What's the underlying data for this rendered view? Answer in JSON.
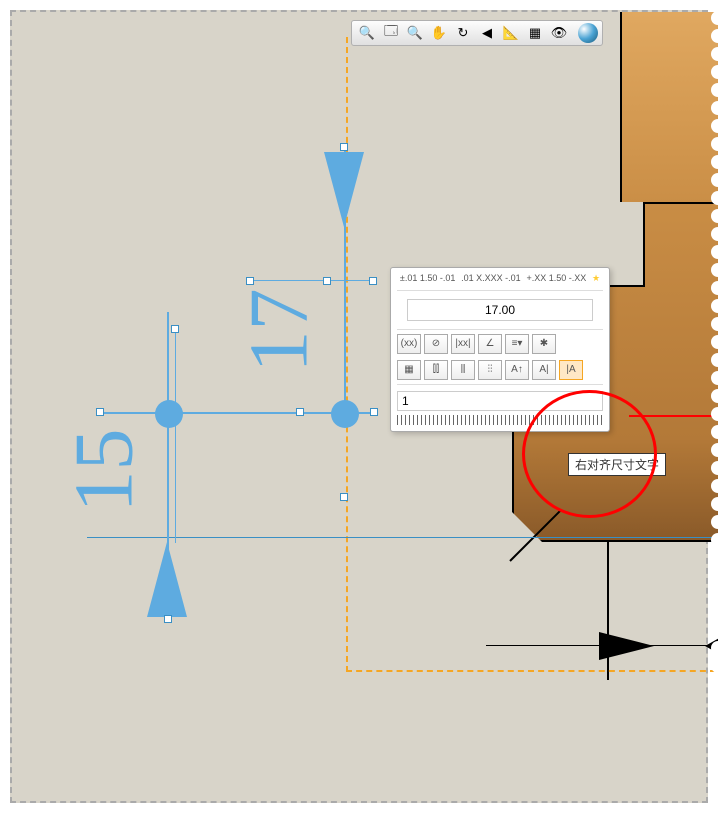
{
  "toolbar": {
    "zoom_area": "🔍",
    "zoom_fit": "🗔",
    "zoom": "🔍",
    "pan": "✋",
    "rotate": "↻",
    "prev_view": "◀",
    "section": "📐",
    "display": "▦",
    "vis": "👁"
  },
  "dimensions": {
    "d15": "15",
    "d17": "17"
  },
  "tolerance_panel": {
    "tol1": "±.01\n1.50\n-.01",
    "tol2": ".01\nX.XXX\n-.01",
    "tol3": "+.XX\n1.50\n-.XX",
    "value": "17.00",
    "count": "1"
  },
  "buttons": {
    "br1": "(xx)",
    "br2": "⊘",
    "br3": "|xx|",
    "br4": "∠",
    "br5": "≡▾",
    "br6": "✱",
    "br7": "▦",
    "br8": "⫿⫿",
    "br9": "⫼",
    "br10": "⫶⫶",
    "br11": "A↑",
    "br12": "A|",
    "br13": "|A"
  },
  "tooltip": "右对齐尺寸文字"
}
